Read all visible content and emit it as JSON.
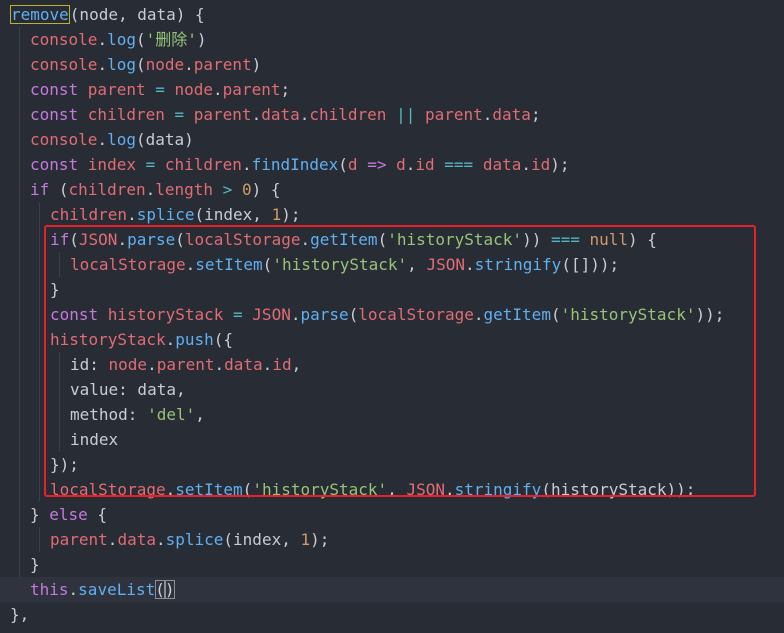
{
  "editor": {
    "highlight_color": "#e8202a",
    "lines": [
      {
        "indent": 0,
        "tokens": [
          [
            "fn-name",
            "remove"
          ],
          [
            "p",
            "(node, data) {"
          ]
        ]
      },
      {
        "indent": 1,
        "tokens": [
          [
            "v",
            "console"
          ],
          [
            "p",
            "."
          ],
          [
            "f",
            "log"
          ],
          [
            "p",
            "("
          ],
          [
            "s",
            "'删除'"
          ],
          [
            "p",
            ")"
          ]
        ]
      },
      {
        "indent": 1,
        "tokens": [
          [
            "v",
            "console"
          ],
          [
            "p",
            "."
          ],
          [
            "f",
            "log"
          ],
          [
            "p",
            "("
          ],
          [
            "v",
            "node"
          ],
          [
            "p",
            "."
          ],
          [
            "v",
            "parent"
          ],
          [
            "p",
            ")"
          ]
        ]
      },
      {
        "indent": 1,
        "tokens": [
          [
            "k",
            "const "
          ],
          [
            "v",
            "parent"
          ],
          [
            "o",
            " = "
          ],
          [
            "v",
            "node"
          ],
          [
            "p",
            "."
          ],
          [
            "v",
            "parent"
          ],
          [
            "p",
            ";"
          ]
        ]
      },
      {
        "indent": 1,
        "tokens": [
          [
            "k",
            "const "
          ],
          [
            "v",
            "children"
          ],
          [
            "o",
            " = "
          ],
          [
            "v",
            "parent"
          ],
          [
            "p",
            "."
          ],
          [
            "v",
            "data"
          ],
          [
            "p",
            "."
          ],
          [
            "v",
            "children"
          ],
          [
            "o",
            " || "
          ],
          [
            "v",
            "parent"
          ],
          [
            "p",
            "."
          ],
          [
            "v",
            "data"
          ],
          [
            "p",
            ";"
          ]
        ]
      },
      {
        "indent": 1,
        "tokens": [
          [
            "v",
            "console"
          ],
          [
            "p",
            "."
          ],
          [
            "f",
            "log"
          ],
          [
            "p",
            "(data)"
          ]
        ]
      },
      {
        "indent": 1,
        "tokens": [
          [
            "k",
            "const "
          ],
          [
            "v",
            "index"
          ],
          [
            "o",
            " = "
          ],
          [
            "v",
            "children"
          ],
          [
            "p",
            "."
          ],
          [
            "f",
            "findIndex"
          ],
          [
            "p",
            "("
          ],
          [
            "v",
            "d"
          ],
          [
            "k",
            " => "
          ],
          [
            "v",
            "d"
          ],
          [
            "p",
            "."
          ],
          [
            "v",
            "id"
          ],
          [
            "o",
            " === "
          ],
          [
            "v",
            "data"
          ],
          [
            "p",
            "."
          ],
          [
            "v",
            "id"
          ],
          [
            "p",
            ");"
          ]
        ]
      },
      {
        "indent": 1,
        "tokens": [
          [
            "k",
            "if "
          ],
          [
            "p",
            "("
          ],
          [
            "v",
            "children"
          ],
          [
            "p",
            "."
          ],
          [
            "v",
            "length"
          ],
          [
            "o",
            " > "
          ],
          [
            "n",
            "0"
          ],
          [
            "p",
            ") {"
          ]
        ]
      },
      {
        "indent": 2,
        "tokens": [
          [
            "v",
            "children"
          ],
          [
            "p",
            "."
          ],
          [
            "f",
            "splice"
          ],
          [
            "p",
            "(index, "
          ],
          [
            "n",
            "1"
          ],
          [
            "p",
            ");"
          ]
        ]
      },
      {
        "indent": 2,
        "tokens": [
          [
            "k",
            "if"
          ],
          [
            "p",
            "("
          ],
          [
            "v",
            "JSON"
          ],
          [
            "p",
            "."
          ],
          [
            "f",
            "parse"
          ],
          [
            "p",
            "("
          ],
          [
            "v",
            "localStorage"
          ],
          [
            "p",
            "."
          ],
          [
            "f",
            "getItem"
          ],
          [
            "p",
            "("
          ],
          [
            "s",
            "'historyStack'"
          ],
          [
            "p",
            "))"
          ],
          [
            "o",
            " === "
          ],
          [
            "n",
            "null"
          ],
          [
            "p",
            ") {"
          ]
        ]
      },
      {
        "indent": 3,
        "tokens": [
          [
            "v",
            "localStorage"
          ],
          [
            "p",
            "."
          ],
          [
            "f",
            "setItem"
          ],
          [
            "p",
            "("
          ],
          [
            "s",
            "'historyStack'"
          ],
          [
            "p",
            ", "
          ],
          [
            "v",
            "JSON"
          ],
          [
            "p",
            "."
          ],
          [
            "f",
            "stringify"
          ],
          [
            "p",
            "([]));"
          ]
        ]
      },
      {
        "indent": 2,
        "tokens": [
          [
            "p",
            "}"
          ]
        ]
      },
      {
        "indent": 2,
        "tokens": [
          [
            "k",
            "const "
          ],
          [
            "v",
            "historyStack"
          ],
          [
            "o",
            " = "
          ],
          [
            "v",
            "JSON"
          ],
          [
            "p",
            "."
          ],
          [
            "f",
            "parse"
          ],
          [
            "p",
            "("
          ],
          [
            "v",
            "localStorage"
          ],
          [
            "p",
            "."
          ],
          [
            "f",
            "getItem"
          ],
          [
            "p",
            "("
          ],
          [
            "s",
            "'historyStack'"
          ],
          [
            "p",
            "));"
          ]
        ]
      },
      {
        "indent": 2,
        "tokens": [
          [
            "v",
            "historyStack"
          ],
          [
            "p",
            "."
          ],
          [
            "f",
            "push"
          ],
          [
            "p",
            "({"
          ]
        ]
      },
      {
        "indent": 3,
        "tokens": [
          [
            "p",
            "id: "
          ],
          [
            "v",
            "node"
          ],
          [
            "p",
            "."
          ],
          [
            "v",
            "parent"
          ],
          [
            "p",
            "."
          ],
          [
            "v",
            "data"
          ],
          [
            "p",
            "."
          ],
          [
            "v",
            "id"
          ],
          [
            "p",
            ","
          ]
        ]
      },
      {
        "indent": 3,
        "tokens": [
          [
            "p",
            "value: data,"
          ]
        ]
      },
      {
        "indent": 3,
        "tokens": [
          [
            "p",
            "method: "
          ],
          [
            "s",
            "'del'"
          ],
          [
            "p",
            ","
          ]
        ]
      },
      {
        "indent": 3,
        "tokens": [
          [
            "p",
            "index"
          ]
        ]
      },
      {
        "indent": 2,
        "tokens": [
          [
            "p",
            "});"
          ]
        ]
      },
      {
        "indent": 2,
        "tokens": [
          [
            "v",
            "localStorage"
          ],
          [
            "p",
            "."
          ],
          [
            "f",
            "setItem"
          ],
          [
            "p",
            "("
          ],
          [
            "s",
            "'historyStack'"
          ],
          [
            "p",
            ", "
          ],
          [
            "v",
            "JSON"
          ],
          [
            "p",
            "."
          ],
          [
            "f",
            "stringify"
          ],
          [
            "p",
            "(historyStack));"
          ]
        ]
      },
      {
        "indent": 1,
        "tokens": [
          [
            "p",
            "} "
          ],
          [
            "k",
            "else"
          ],
          [
            "p",
            " {"
          ]
        ]
      },
      {
        "indent": 2,
        "tokens": [
          [
            "v",
            "parent"
          ],
          [
            "p",
            "."
          ],
          [
            "v",
            "data"
          ],
          [
            "p",
            "."
          ],
          [
            "f",
            "splice"
          ],
          [
            "p",
            "(index, "
          ],
          [
            "n",
            "1"
          ],
          [
            "p",
            ");"
          ]
        ]
      },
      {
        "indent": 1,
        "tokens": [
          [
            "p",
            "}"
          ]
        ]
      },
      {
        "indent": 1,
        "current": true,
        "tokens": [
          [
            "k",
            "this"
          ],
          [
            "p",
            "."
          ],
          [
            "f",
            "saveList"
          ],
          [
            "paren-hl",
            "("
          ],
          [
            "paren-hl",
            ")"
          ]
        ]
      },
      {
        "indent": 0,
        "tokens": [
          [
            "p",
            "},"
          ]
        ]
      }
    ]
  }
}
